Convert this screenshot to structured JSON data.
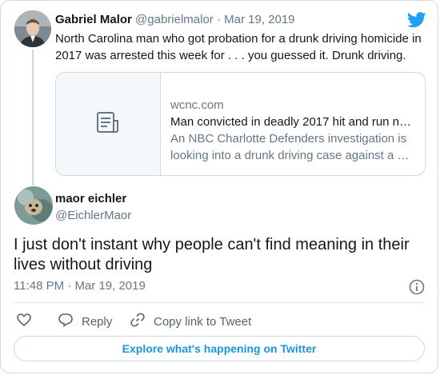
{
  "quoted_tweet": {
    "author_name": "Gabriel Malor",
    "author_handle": "@gabrielmalor",
    "separator": "·",
    "date": "Mar 19, 2019",
    "text_line1": "North Carolina man who got probation for a drunk driving homicide in",
    "text_line2": "2017 was arrested this week for . . . you guessed it. Drunk driving.",
    "link_card": {
      "domain": "wcnc.com",
      "title": "Man convicted in deadly 2017 hit and run n…",
      "description_line1": "An NBC Charlotte Defenders investigation is",
      "description_line2": "looking into a drunk driving case against a …"
    }
  },
  "main_tweet": {
    "author_name": "maor eichler",
    "author_handle": "@EichlerMaor",
    "text_line1": "I just don't instant why people can't find meaning in their",
    "text_line2": "lives without driving",
    "time": "11:48 PM",
    "separator": "·",
    "date": "Mar 19, 2019"
  },
  "actions": {
    "reply_label": "Reply",
    "copy_link_label": "Copy link to Tweet"
  },
  "explore_button_label": "Explore what's happening on Twitter",
  "colors": {
    "twitter_blue": "#1DA1F2",
    "link_blue": "#1b95e0",
    "muted": "#657786",
    "border": "#cfd9de"
  },
  "icons": [
    "twitter-bird-icon",
    "article-icon",
    "info-icon",
    "heart-icon",
    "reply-icon",
    "link-icon"
  ]
}
